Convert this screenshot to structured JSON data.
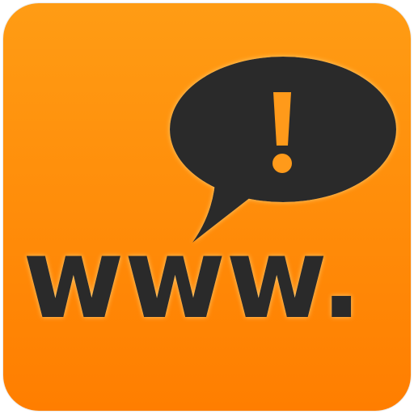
{
  "icon": {
    "semantic_name": "www-alert-speech-bubble-icon",
    "text": "www.",
    "bubble_symbol": "!",
    "colors": {
      "background_top": "#ff9c14",
      "background_bottom": "#ff7e00",
      "dark_fill": "#2b2b2b",
      "glow": "#ffd27a",
      "exclamation": "#ff9a1a"
    }
  }
}
